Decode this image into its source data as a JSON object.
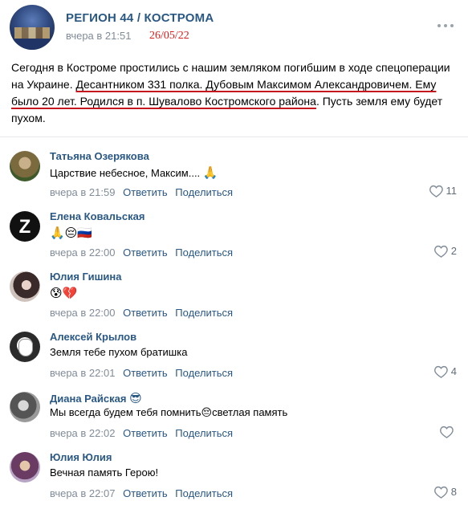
{
  "post": {
    "group_name": "РЕГИОН 44 / КОСТРОМА",
    "time": "вчера в 21:51",
    "date_stamp": "26/05/22",
    "text_part1": "Сегодня в Костроме простились с нашим земляком погибшим в ходе спецоперации на Украине. ",
    "text_highlight": "Десантником 331 полка. Дубовым Максимом Александровичем. Ему было 20 лет. Родился в п. Шувалово Костромского района",
    "text_part2": ". Пусть земля ему будет пухом."
  },
  "actions": {
    "reply": "Ответить",
    "share": "Поделиться"
  },
  "comments": [
    {
      "author": "Татьяна Озерякова",
      "text": "Царствие небесное, Максим....",
      "emoji": "🙏",
      "time": "вчера в 21:59",
      "likes": "11"
    },
    {
      "author": "Елена Ковальская",
      "text": "",
      "emoji": "🙏😔🇷🇺",
      "time": "вчера в 22:00",
      "likes": "2",
      "avatar_letter": "Z"
    },
    {
      "author": "Юлия Гишина",
      "text": "",
      "emoji": "😰💔",
      "time": "вчера в 22:00",
      "likes": ""
    },
    {
      "author": "Алексей Крылов",
      "text": "Земля тебе пухом братишка",
      "emoji": "",
      "time": "вчера в 22:01",
      "likes": "4"
    },
    {
      "author": "Диана Райская",
      "author_emoji": "😎",
      "text": "Мы всегда будем тебя помнить😔светлая память",
      "emoji": "",
      "time": "вчера в 22:02",
      "likes": ""
    },
    {
      "author": "Юлия Юлия",
      "text": "Вечная память Герою!",
      "emoji": "",
      "time": "вчера в 22:07",
      "likes": "8"
    }
  ],
  "colors": {
    "link": "#2a5885",
    "meta": "#818c99",
    "stamp": "#d91b1b",
    "underline": "#c4161c"
  }
}
